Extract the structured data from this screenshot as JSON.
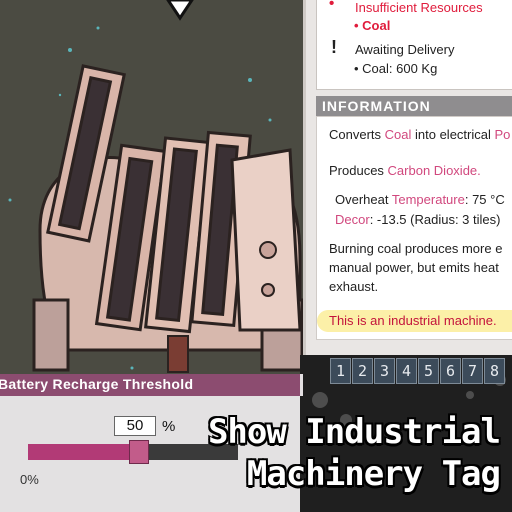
{
  "status": {
    "insufficient_label": "Insufficient Resources",
    "insufficient_item": "• Coal",
    "insufficient_icon": "red-dot-icon",
    "delivery_label": "Awaiting Delivery",
    "delivery_item": "• Coal: 600 Kg",
    "delivery_icon": "exclamation-icon"
  },
  "information": {
    "header": "INFORMATION",
    "converts_pre": "Converts ",
    "converts_hl1": "Coal",
    "converts_mid": " into electrical ",
    "converts_hl2": "Po",
    "produces_pre": "Produces ",
    "produces_hl": "Carbon Dioxide.",
    "overheat_pre": "Overheat ",
    "overheat_hl": "Temperature",
    "overheat_val": ": 75 °C",
    "decor_hl": "Decor",
    "decor_val": ": -13.5 (Radius: 3 tiles)",
    "burn_1": "Burning coal produces more e",
    "burn_2": "manual power, but emits heat",
    "burn_3": "exhaust.",
    "tag_line": "This is an industrial machine."
  },
  "number_buttons": [
    "1",
    "2",
    "3",
    "4",
    "5",
    "6",
    "7",
    "8"
  ],
  "battery": {
    "title": "Battery Recharge Threshold",
    "value": "50",
    "unit": "%",
    "min_label": "0%",
    "fraction": 0.5
  },
  "caption": {
    "line1": "Show Industrial",
    "line2": "Machinery Tag"
  },
  "colors": {
    "accent_pink": "#d1487e",
    "alert_red": "#e01c3c",
    "battery_purple": "#8c4c70",
    "tag_highlight": "#fcf0a8"
  }
}
